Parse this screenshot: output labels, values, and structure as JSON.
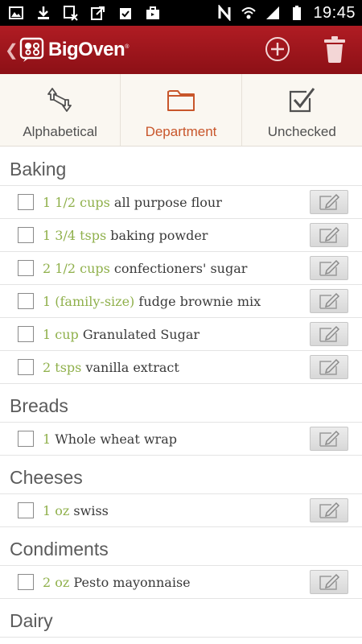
{
  "status_bar": {
    "time": "19:45",
    "icons": [
      "image-icon",
      "download-icon",
      "mute-card-icon",
      "share-icon",
      "clipboard-check-icon",
      "briefcase-icon",
      "nfc-icon",
      "wifi-icon",
      "signal-icon",
      "battery-icon"
    ]
  },
  "app_bar": {
    "app_name": "BigOven",
    "trademark": "®",
    "colors": {
      "bar": "#a3161d",
      "accent": "#c8562b",
      "quantity": "#8fb04b"
    }
  },
  "sort_tabs": [
    {
      "label": "Alphabetical",
      "icon": "sort-arrows-icon",
      "active": false
    },
    {
      "label": "Department",
      "icon": "folder-icon",
      "active": true
    },
    {
      "label": "Unchecked",
      "icon": "checkbox-checked-icon",
      "active": false
    }
  ],
  "sections": [
    {
      "name": "Baking",
      "items": [
        {
          "qty": "1 1/2 cups",
          "name": "all purpose flour"
        },
        {
          "qty": "1 3/4 tsps",
          "name": "baking powder"
        },
        {
          "qty": "2 1/2 cups",
          "name": "confectioners' sugar"
        },
        {
          "qty": "1 (family-size)",
          "name": "fudge brownie mix"
        },
        {
          "qty": "1 cup",
          "name": "Granulated Sugar"
        },
        {
          "qty": "2 tsps",
          "name": "vanilla extract"
        }
      ]
    },
    {
      "name": "Breads",
      "items": [
        {
          "qty": "1",
          "name": "Whole wheat wrap"
        }
      ]
    },
    {
      "name": "Cheeses",
      "items": [
        {
          "qty": "1 oz",
          "name": "swiss"
        }
      ]
    },
    {
      "name": "Condiments",
      "items": [
        {
          "qty": "2 oz",
          "name": "Pesto mayonnaise"
        }
      ]
    },
    {
      "name": "Dairy",
      "items": []
    }
  ]
}
